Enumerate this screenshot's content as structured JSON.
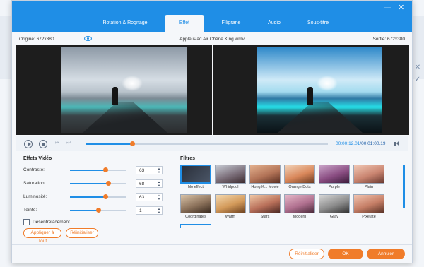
{
  "window_controls": {
    "minimize": "—",
    "close": "✕"
  },
  "tabs": [
    {
      "label": "Rotation & Rognage",
      "active": false
    },
    {
      "label": "Effet",
      "active": true
    },
    {
      "label": "Filigrane",
      "active": false
    },
    {
      "label": "Audio",
      "active": false
    },
    {
      "label": "Sous-titre",
      "active": false
    }
  ],
  "info": {
    "origin": "Origine: 672x380",
    "filename": "Apple iPad Air Chérie King.wmv",
    "output": "Sortie: 672x380"
  },
  "playback": {
    "current": "00:00:12.01",
    "total": "/00:01:00.19",
    "progress": 0.19
  },
  "effects": {
    "title": "Effets Vidéo",
    "adjustments": [
      {
        "label": "Contraste:",
        "value": "63",
        "level": 0.63
      },
      {
        "label": "Saturation:",
        "value": "68",
        "level": 0.68
      },
      {
        "label": "Luminosité:",
        "value": "63",
        "level": 0.63
      },
      {
        "label": "Teinte:",
        "value": "1",
        "level": 0.5
      }
    ],
    "deinterlace_label": "Désentrelacement",
    "apply_all": "Appliquer à Tout",
    "reset": "Réinitialiser"
  },
  "filters": {
    "title": "Filtres",
    "items": [
      {
        "name": "No effect",
        "selected": true
      },
      {
        "name": "Whirlpool",
        "selected": false
      },
      {
        "name": "Hong K... Movie",
        "selected": false
      },
      {
        "name": "Orange Dots",
        "selected": false
      },
      {
        "name": "Purple",
        "selected": false
      },
      {
        "name": "Plain",
        "selected": false
      },
      {
        "name": "Coordinates",
        "selected": false
      },
      {
        "name": "Warm",
        "selected": false
      },
      {
        "name": "Stars",
        "selected": false
      },
      {
        "name": "Modern",
        "selected": false
      },
      {
        "name": "Gray",
        "selected": false
      },
      {
        "name": "Pixelate",
        "selected": false
      }
    ]
  },
  "footer": {
    "reset": "Réinitialiser",
    "ok": "OK",
    "cancel": "Annuler"
  },
  "colors": {
    "accent": "#1f8ee6",
    "action": "#f07c2a"
  }
}
